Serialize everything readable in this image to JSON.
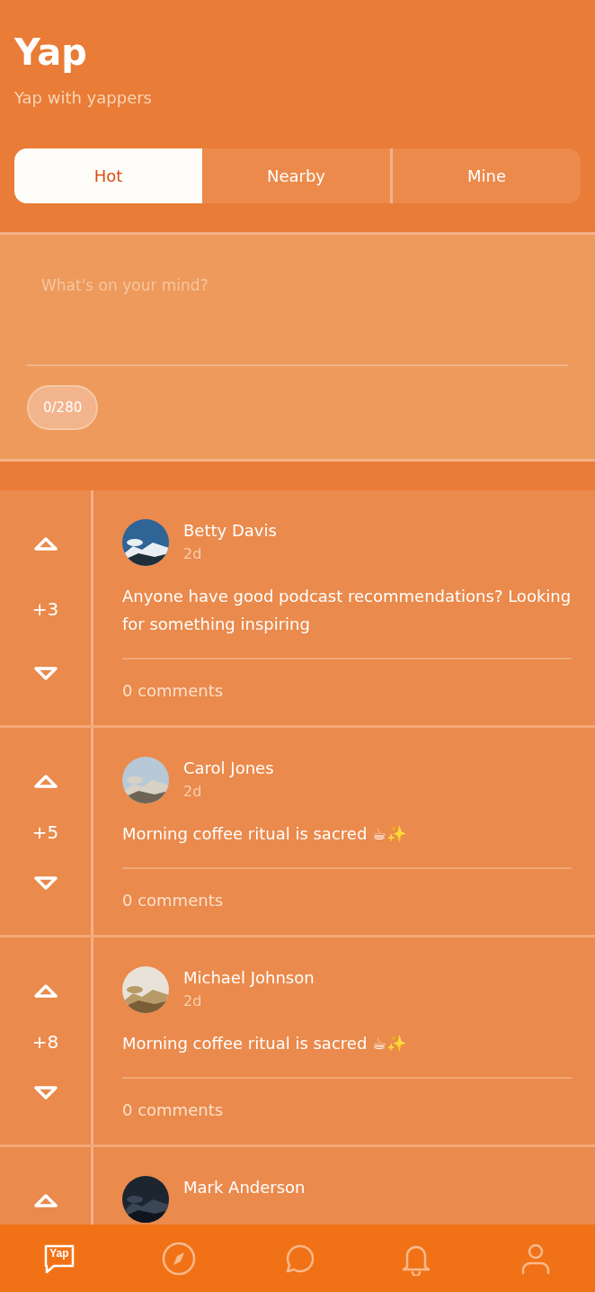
{
  "app": {
    "title": "Yap",
    "subtitle": "Yap with yappers"
  },
  "tabs": [
    {
      "label": "Hot",
      "selected": true
    },
    {
      "label": "Nearby",
      "selected": false
    },
    {
      "label": "Mine",
      "selected": false
    }
  ],
  "composer": {
    "placeholder": "What's on your mind?",
    "counter": "0/280"
  },
  "posts": [
    {
      "author": "Betty Davis",
      "time": "2d",
      "score": "+3",
      "text": "Anyone have good podcast recommendations? Looking for something inspiring",
      "comments": "0 comments"
    },
    {
      "author": "Carol Jones",
      "time": "2d",
      "score": "+5",
      "text": "Morning coffee ritual is sacred ☕✨",
      "comments": "0 comments"
    },
    {
      "author": "Michael Johnson",
      "time": "2d",
      "score": "+8",
      "text": "Morning coffee ritual is sacred ☕✨",
      "comments": "0 comments"
    },
    {
      "author": "Mark Anderson"
    }
  ],
  "nav": [
    {
      "kind": "home",
      "label": "Yap",
      "selected": true
    },
    {
      "kind": "explore",
      "selected": false
    },
    {
      "kind": "chat",
      "selected": false
    },
    {
      "kind": "bell",
      "selected": false
    },
    {
      "kind": "profile",
      "selected": false
    }
  ]
}
